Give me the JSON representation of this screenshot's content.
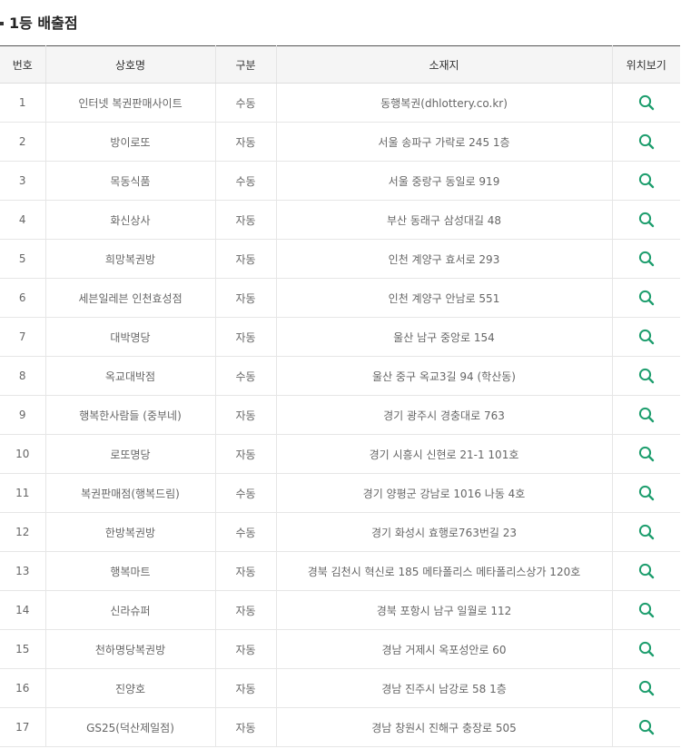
{
  "section": {
    "title": "1등 배출점"
  },
  "colors": {
    "accent": "#1e9e6e",
    "header_bg": "#f5f5f5"
  },
  "table": {
    "headers": [
      "번호",
      "상호명",
      "구분",
      "소재지",
      "위치보기"
    ],
    "location_icon": "search-icon",
    "rows": [
      {
        "no": "1",
        "name": "인터넷 복권판매사이트",
        "type": "수동",
        "address": "동행복권(dhlottery.co.kr)"
      },
      {
        "no": "2",
        "name": "방이로또",
        "type": "자동",
        "address": "서울 송파구 가락로 245 1층"
      },
      {
        "no": "3",
        "name": "목동식품",
        "type": "수동",
        "address": "서울 중랑구 동일로 919"
      },
      {
        "no": "4",
        "name": "화신상사",
        "type": "자동",
        "address": "부산 동래구 삼성대길 48"
      },
      {
        "no": "5",
        "name": "희망복권방",
        "type": "자동",
        "address": "인천 계양구 효서로 293"
      },
      {
        "no": "6",
        "name": "세븐일레븐 인천효성점",
        "type": "자동",
        "address": "인천 계양구 안남로 551"
      },
      {
        "no": "7",
        "name": "대박명당",
        "type": "자동",
        "address": "울산 남구 중앙로 154"
      },
      {
        "no": "8",
        "name": "옥교대박점",
        "type": "수동",
        "address": "울산 중구 옥교3길 94 (학산동)"
      },
      {
        "no": "9",
        "name": "행복한사람들 (중부네)",
        "type": "자동",
        "address": "경기 광주시 경충대로 763"
      },
      {
        "no": "10",
        "name": "로또명당",
        "type": "자동",
        "address": "경기 시흥시 신현로 21-1 101호"
      },
      {
        "no": "11",
        "name": "복권판매점(행복드림)",
        "type": "수동",
        "address": "경기 양평군 강남로 1016 나동 4호"
      },
      {
        "no": "12",
        "name": "한방복권방",
        "type": "수동",
        "address": "경기 화성시 효행로763번길 23"
      },
      {
        "no": "13",
        "name": "행복마트",
        "type": "자동",
        "address": "경북 김천시 혁신로 185 메타폴리스 메타폴리스상가 120호"
      },
      {
        "no": "14",
        "name": "신라슈퍼",
        "type": "자동",
        "address": "경북 포항시 남구 일월로 112"
      },
      {
        "no": "15",
        "name": "천하명당복권방",
        "type": "자동",
        "address": "경남 거제시 옥포성안로 60"
      },
      {
        "no": "16",
        "name": "진양호",
        "type": "자동",
        "address": "경남 진주시 남강로 58 1층"
      },
      {
        "no": "17",
        "name": "GS25(덕산제일점)",
        "type": "자동",
        "address": "경남 창원시 진해구 충장로 505"
      }
    ]
  }
}
